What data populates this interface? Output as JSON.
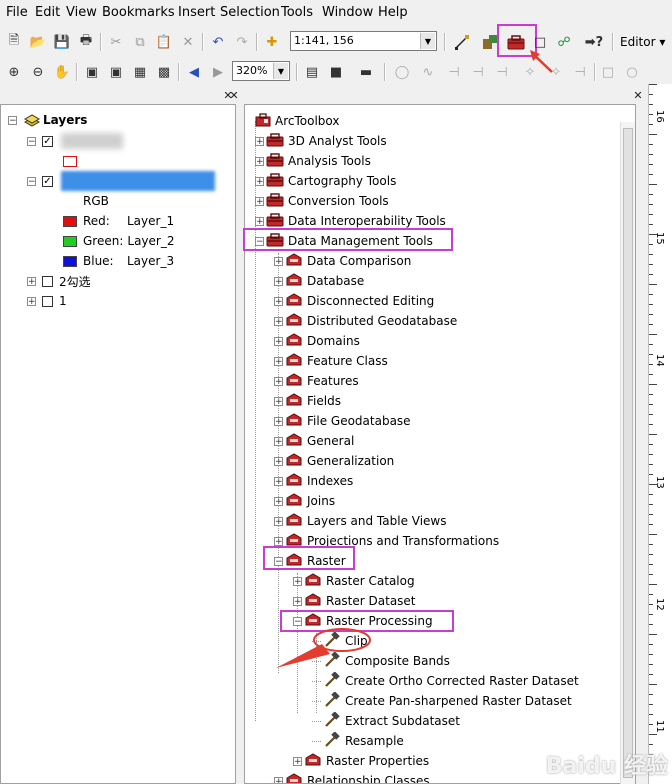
{
  "menu": [
    "File",
    "Edit",
    "View",
    "Bookmarks",
    "Insert",
    "Selection",
    "Tools",
    "Window",
    "Help"
  ],
  "toolbar": {
    "scale_value": "1:141, 156",
    "zoom_value": "320%",
    "editor_label": "Editor ▾"
  },
  "toc": {
    "root_label": "Layers",
    "rgb_label": "RGB",
    "bands": [
      {
        "key": "Red:",
        "layer": "Layer_1",
        "color": "#e01010"
      },
      {
        "key": "Green:",
        "layer": "Layer_2",
        "color": "#22cc22"
      },
      {
        "key": "Blue:",
        "layer": "Layer_3",
        "color": "#1010d8"
      }
    ],
    "layer_a": "2勾选",
    "layer_b": "1"
  },
  "toolbox": {
    "root": "ArcToolbox",
    "top_tools": [
      "3D Analyst Tools",
      "Analysis Tools",
      "Cartography Tools",
      "Conversion Tools",
      "Data Interoperability Tools",
      "Data Management Tools"
    ],
    "dm_children": [
      "Data Comparison",
      "Database",
      "Disconnected Editing",
      "Distributed Geodatabase",
      "Domains",
      "Feature Class",
      "Features",
      "Fields",
      "File Geodatabase",
      "General",
      "Generalization",
      "Indexes",
      "Joins",
      "Layers and Table Views",
      "Projections and Transformations",
      "Raster"
    ],
    "raster_children": [
      "Raster Catalog",
      "Raster Dataset",
      "Raster Processing"
    ],
    "raster_processing_tools": [
      "Clip",
      "Composite Bands",
      "Create Ortho Corrected Raster Dataset",
      "Create Pan-sharpened Raster Dataset",
      "Extract Subdataset",
      "Resample"
    ],
    "after": [
      "Raster Properties",
      "Relationship Classes"
    ]
  },
  "ruler_numbers": [
    "16",
    "15",
    "14",
    "13",
    "12",
    "11"
  ],
  "watermark": "Baidu 经验",
  "colors": {
    "highlight": "#c83cd4",
    "arrow": "#e33b2e",
    "toolbox_red": "#c0282a"
  }
}
